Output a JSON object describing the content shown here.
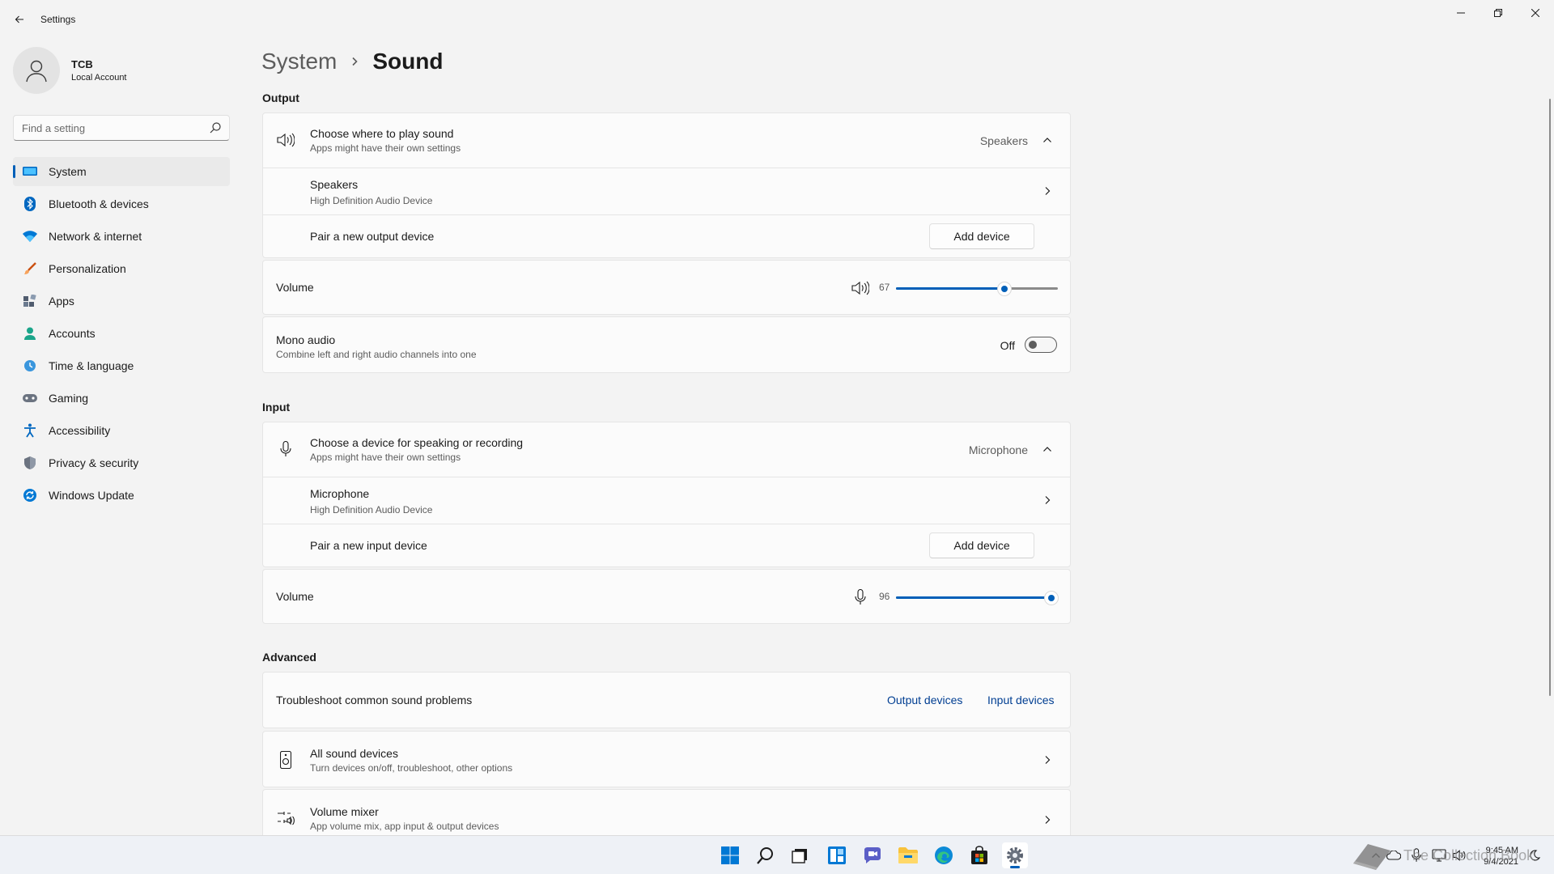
{
  "window": {
    "title": "Settings",
    "controls": {
      "minimize": "minimize-icon",
      "maximize": "restore-icon",
      "close": "close-icon"
    }
  },
  "profile": {
    "name": "TCB",
    "account_type": "Local Account"
  },
  "search": {
    "placeholder": "Find a setting"
  },
  "sidebar": {
    "items": [
      {
        "label": "System",
        "icon": "system-icon",
        "selected": true
      },
      {
        "label": "Bluetooth & devices",
        "icon": "bluetooth-icon"
      },
      {
        "label": "Network & internet",
        "icon": "wifi-icon"
      },
      {
        "label": "Personalization",
        "icon": "brush-icon"
      },
      {
        "label": "Apps",
        "icon": "apps-icon"
      },
      {
        "label": "Accounts",
        "icon": "person-icon"
      },
      {
        "label": "Time & language",
        "icon": "clock-globe-icon"
      },
      {
        "label": "Gaming",
        "icon": "gamepad-icon"
      },
      {
        "label": "Accessibility",
        "icon": "accessibility-icon"
      },
      {
        "label": "Privacy & security",
        "icon": "shield-icon"
      },
      {
        "label": "Windows Update",
        "icon": "update-icon"
      }
    ]
  },
  "breadcrumb": {
    "parent": "System",
    "current": "Sound"
  },
  "output": {
    "section_title": "Output",
    "choose": {
      "title": "Choose where to play sound",
      "subtitle": "Apps might have their own settings",
      "value": "Speakers"
    },
    "device": {
      "name": "Speakers",
      "description": "High Definition Audio Device"
    },
    "pair": {
      "label": "Pair a new output device",
      "button": "Add device"
    },
    "volume": {
      "label": "Volume",
      "value": "67",
      "level": 0.67
    },
    "mono": {
      "title": "Mono audio",
      "subtitle": "Combine left and right audio channels into one",
      "state": "Off"
    }
  },
  "input": {
    "section_title": "Input",
    "choose": {
      "title": "Choose a device for speaking or recording",
      "subtitle": "Apps might have their own settings",
      "value": "Microphone"
    },
    "device": {
      "name": "Microphone",
      "description": "High Definition Audio Device"
    },
    "pair": {
      "label": "Pair a new input device",
      "button": "Add device"
    },
    "volume": {
      "label": "Volume",
      "value": "96",
      "level": 0.96
    }
  },
  "advanced": {
    "section_title": "Advanced",
    "troubleshoot": {
      "label": "Troubleshoot common sound problems",
      "output_link": "Output devices",
      "input_link": "Input devices"
    },
    "all_devices": {
      "title": "All sound devices",
      "subtitle": "Turn devices on/off, troubleshoot, other options"
    },
    "mixer": {
      "title": "Volume mixer",
      "subtitle": "App volume mix, app input & output devices"
    }
  },
  "taskbar": {
    "apps": [
      "windows-start-icon",
      "search-icon",
      "task-view-icon",
      "widgets-icon",
      "chat-icon",
      "file-explorer-icon",
      "edge-icon",
      "store-icon",
      "settings-icon"
    ],
    "clock": {
      "time": "9:45 AM",
      "date": "9/4/2021"
    },
    "watermark": "The Collection Book"
  },
  "colors": {
    "accent": "#005fb8",
    "background": "#f3f3f3",
    "card": "#fbfbfb",
    "link": "#003e92"
  }
}
